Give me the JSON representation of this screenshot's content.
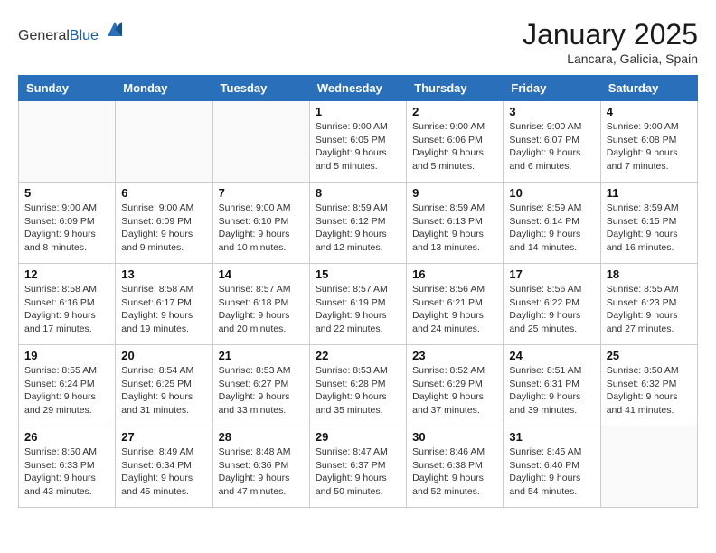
{
  "header": {
    "logo_general": "General",
    "logo_blue": "Blue",
    "title": "January 2025",
    "subtitle": "Lancara, Galicia, Spain"
  },
  "weekdays": [
    "Sunday",
    "Monday",
    "Tuesday",
    "Wednesday",
    "Thursday",
    "Friday",
    "Saturday"
  ],
  "weeks": [
    [
      null,
      null,
      null,
      {
        "day": 1,
        "sunrise": "9:00 AM",
        "sunset": "6:05 PM",
        "daylight": "9 hours and 5 minutes."
      },
      {
        "day": 2,
        "sunrise": "9:00 AM",
        "sunset": "6:06 PM",
        "daylight": "9 hours and 5 minutes."
      },
      {
        "day": 3,
        "sunrise": "9:00 AM",
        "sunset": "6:07 PM",
        "daylight": "9 hours and 6 minutes."
      },
      {
        "day": 4,
        "sunrise": "9:00 AM",
        "sunset": "6:08 PM",
        "daylight": "9 hours and 7 minutes."
      }
    ],
    [
      {
        "day": 5,
        "sunrise": "9:00 AM",
        "sunset": "6:09 PM",
        "daylight": "9 hours and 8 minutes."
      },
      {
        "day": 6,
        "sunrise": "9:00 AM",
        "sunset": "6:09 PM",
        "daylight": "9 hours and 9 minutes."
      },
      {
        "day": 7,
        "sunrise": "9:00 AM",
        "sunset": "6:10 PM",
        "daylight": "9 hours and 10 minutes."
      },
      {
        "day": 8,
        "sunrise": "8:59 AM",
        "sunset": "6:12 PM",
        "daylight": "9 hours and 12 minutes."
      },
      {
        "day": 9,
        "sunrise": "8:59 AM",
        "sunset": "6:13 PM",
        "daylight": "9 hours and 13 minutes."
      },
      {
        "day": 10,
        "sunrise": "8:59 AM",
        "sunset": "6:14 PM",
        "daylight": "9 hours and 14 minutes."
      },
      {
        "day": 11,
        "sunrise": "8:59 AM",
        "sunset": "6:15 PM",
        "daylight": "9 hours and 16 minutes."
      }
    ],
    [
      {
        "day": 12,
        "sunrise": "8:58 AM",
        "sunset": "6:16 PM",
        "daylight": "9 hours and 17 minutes."
      },
      {
        "day": 13,
        "sunrise": "8:58 AM",
        "sunset": "6:17 PM",
        "daylight": "9 hours and 19 minutes."
      },
      {
        "day": 14,
        "sunrise": "8:57 AM",
        "sunset": "6:18 PM",
        "daylight": "9 hours and 20 minutes."
      },
      {
        "day": 15,
        "sunrise": "8:57 AM",
        "sunset": "6:19 PM",
        "daylight": "9 hours and 22 minutes."
      },
      {
        "day": 16,
        "sunrise": "8:56 AM",
        "sunset": "6:21 PM",
        "daylight": "9 hours and 24 minutes."
      },
      {
        "day": 17,
        "sunrise": "8:56 AM",
        "sunset": "6:22 PM",
        "daylight": "9 hours and 25 minutes."
      },
      {
        "day": 18,
        "sunrise": "8:55 AM",
        "sunset": "6:23 PM",
        "daylight": "9 hours and 27 minutes."
      }
    ],
    [
      {
        "day": 19,
        "sunrise": "8:55 AM",
        "sunset": "6:24 PM",
        "daylight": "9 hours and 29 minutes."
      },
      {
        "day": 20,
        "sunrise": "8:54 AM",
        "sunset": "6:25 PM",
        "daylight": "9 hours and 31 minutes."
      },
      {
        "day": 21,
        "sunrise": "8:53 AM",
        "sunset": "6:27 PM",
        "daylight": "9 hours and 33 minutes."
      },
      {
        "day": 22,
        "sunrise": "8:53 AM",
        "sunset": "6:28 PM",
        "daylight": "9 hours and 35 minutes."
      },
      {
        "day": 23,
        "sunrise": "8:52 AM",
        "sunset": "6:29 PM",
        "daylight": "9 hours and 37 minutes."
      },
      {
        "day": 24,
        "sunrise": "8:51 AM",
        "sunset": "6:31 PM",
        "daylight": "9 hours and 39 minutes."
      },
      {
        "day": 25,
        "sunrise": "8:50 AM",
        "sunset": "6:32 PM",
        "daylight": "9 hours and 41 minutes."
      }
    ],
    [
      {
        "day": 26,
        "sunrise": "8:50 AM",
        "sunset": "6:33 PM",
        "daylight": "9 hours and 43 minutes."
      },
      {
        "day": 27,
        "sunrise": "8:49 AM",
        "sunset": "6:34 PM",
        "daylight": "9 hours and 45 minutes."
      },
      {
        "day": 28,
        "sunrise": "8:48 AM",
        "sunset": "6:36 PM",
        "daylight": "9 hours and 47 minutes."
      },
      {
        "day": 29,
        "sunrise": "8:47 AM",
        "sunset": "6:37 PM",
        "daylight": "9 hours and 50 minutes."
      },
      {
        "day": 30,
        "sunrise": "8:46 AM",
        "sunset": "6:38 PM",
        "daylight": "9 hours and 52 minutes."
      },
      {
        "day": 31,
        "sunrise": "8:45 AM",
        "sunset": "6:40 PM",
        "daylight": "9 hours and 54 minutes."
      },
      null
    ]
  ],
  "colors": {
    "header_bg": "#2a6fba",
    "header_text": "#ffffff",
    "border": "#cccccc"
  }
}
